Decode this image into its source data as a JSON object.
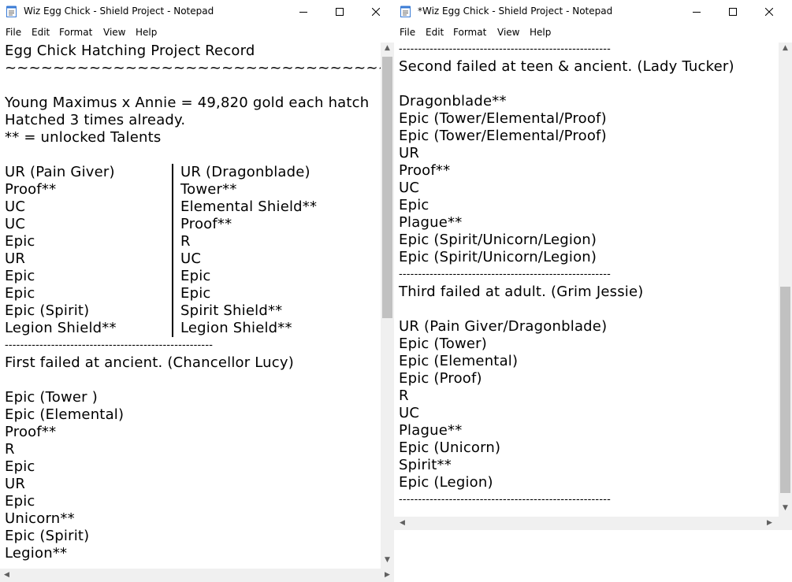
{
  "windows": {
    "left": {
      "title": "Wiz Egg Chick - Shield Project - Notepad",
      "menu": [
        "File",
        "Edit",
        "Format",
        "View",
        "Help"
      ],
      "lines": [
        "Egg Chick Hatching Project Record",
        "~~~~~~~~~~~~~~~~~~~~~~~~~~~~~~~~~~~~~",
        "",
        "Young Maximus x Annie = 49,820 gold each hatch",
        "Hatched 3 times already.",
        "** = unlocked Talents",
        "",
        "UR (Pain Giver)",
        "Proof**",
        "UC",
        "UC",
        "Epic",
        "UR",
        "Epic",
        "Epic",
        "Epic (Spirit)",
        "Legion Shield**",
        "------------------------------------------------------",
        "First failed at ancient. (Chancellor Lucy)",
        "",
        "Epic (Tower )",
        "Epic (Elemental)",
        "Proof**",
        "R",
        "Epic",
        "UR",
        "Epic",
        "Unicorn**",
        "Epic (Spirit)",
        "Legion**"
      ],
      "right_col": [
        "UR (Dragonblade)",
        "Tower**",
        "Elemental Shield**",
        "Proof**",
        "R",
        "UC",
        "Epic",
        "Epic",
        "Spirit Shield**",
        "Legion Shield**"
      ]
    },
    "right": {
      "title": "*Wiz Egg Chick - Shield Project - Notepad",
      "menu": [
        "File",
        "Edit",
        "Format",
        "View",
        "Help"
      ],
      "lines": [
        "-------------------------------------------------------",
        "Second failed at teen & ancient. (Lady Tucker)",
        "",
        "Dragonblade**",
        "Epic (Tower/Elemental/Proof)",
        "Epic (Tower/Elemental/Proof)",
        "UR",
        "Proof**",
        "UC",
        "Epic",
        "Plague**",
        "Epic (Spirit/Unicorn/Legion)",
        "Epic (Spirit/Unicorn/Legion)",
        "-------------------------------------------------------",
        "Third failed at adult. (Grim Jessie)",
        "",
        "UR (Pain Giver/Dragonblade)",
        "Epic (Tower)",
        "Epic (Elemental)",
        "Epic (Proof)",
        "R",
        "UC",
        "Plague**",
        "Epic (Unicorn)",
        "Spirit**",
        "Epic (Legion)",
        "-------------------------------------------------------"
      ]
    }
  },
  "icons": {
    "minimize": "minimize-icon",
    "maximize": "maximize-icon",
    "close": "close-icon",
    "app": "notepad-icon"
  },
  "colors": {
    "scrollbar_track": "#f0f0f0",
    "scrollbar_thumb": "#c1c1c1"
  }
}
